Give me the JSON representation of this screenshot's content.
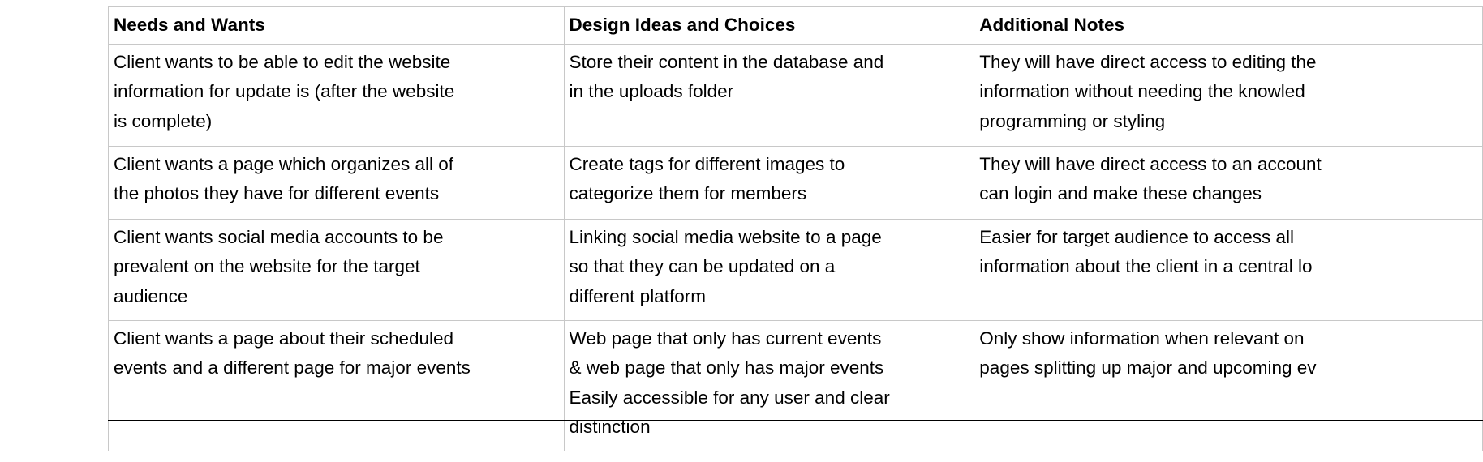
{
  "table": {
    "headers": [
      "Needs and Wants",
      "Design Ideas and Choices",
      "Additional Notes"
    ],
    "rows": [
      [
        [
          "Client wants to be able to edit the website",
          "information for update is (after the website",
          "is complete)"
        ],
        [
          "Store their content in the database and",
          "in the uploads folder"
        ],
        [
          "They will have direct access to editing the",
          "information without needing the knowled",
          "programming or styling"
        ]
      ],
      [
        [
          "Client wants a page which organizes all of",
          "the photos they have for different events"
        ],
        [
          "Create tags for different images to",
          "categorize them for members"
        ],
        [
          "They will have direct access to an account",
          "can login and make these changes"
        ]
      ],
      [
        [
          "Client wants social media accounts to be",
          "prevalent on the website for the target",
          "audience"
        ],
        [
          "Linking social media website to a page",
          "so that they can be updated on a",
          "different platform"
        ],
        [
          "Easier for target audience to access all",
          "information about the client in a central lo"
        ]
      ],
      [
        [
          "Client wants a page about their scheduled",
          "events and a different page for major events"
        ],
        [
          "Web page that only has current events",
          "& web page that only has major events",
          "Easily accessible for any user and clear",
          "distinction"
        ],
        [
          "Only show information when relevant on",
          "pages splitting up major and upcoming ev"
        ]
      ]
    ]
  }
}
